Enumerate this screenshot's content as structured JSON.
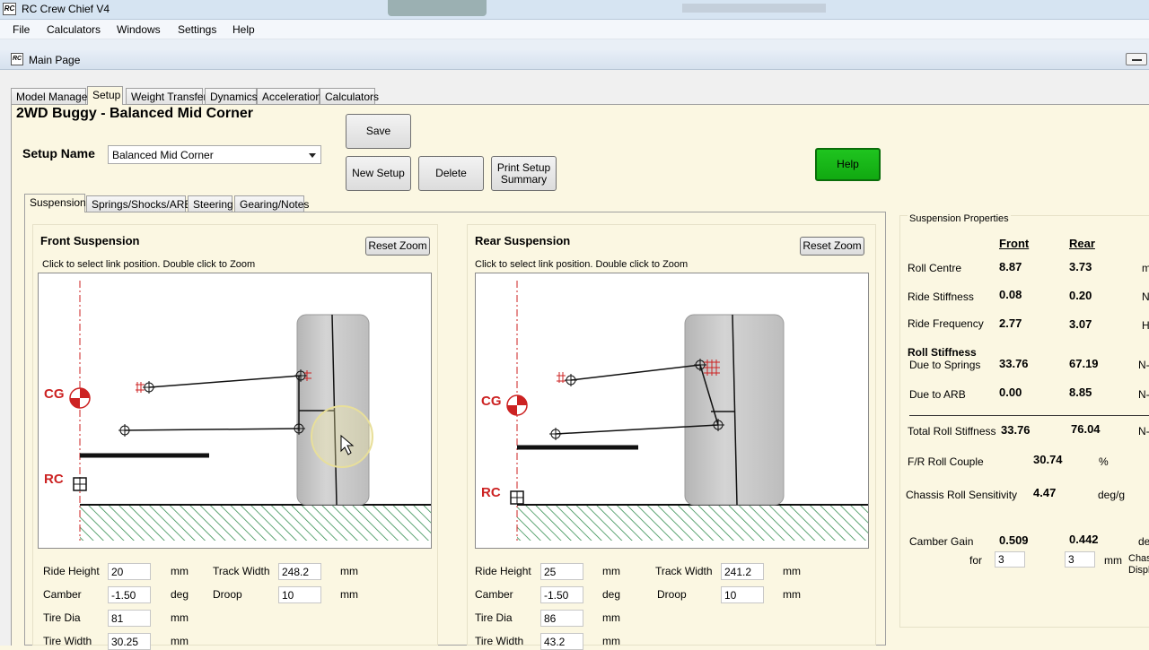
{
  "app": {
    "window_title": "RC Crew Chief V4",
    "menu": [
      "File",
      "Calculators",
      "Windows",
      "Settings",
      "Help"
    ]
  },
  "mdi": {
    "title": "Main Page"
  },
  "main_tabs": [
    "Model Manager",
    "Setup",
    "Weight Transfer",
    "Dynamics",
    "Acceleration",
    "Calculators"
  ],
  "model_title": "2WD Buggy - Balanced Mid Corner",
  "setup": {
    "name_label": "Setup Name",
    "selected": "Balanced Mid Corner"
  },
  "buttons": {
    "save": "Save",
    "new_setup": "New Setup",
    "delete": "Delete",
    "print_line1": "Print Setup",
    "print_line2": "Summary",
    "help": "Help"
  },
  "inner_tabs": [
    "Suspension",
    "Springs/Shocks/ARB",
    "Steering",
    "Gearing/Notes"
  ],
  "front": {
    "title": "Front Suspension",
    "reset_zoom": "Reset Zoom",
    "hint": "Click to select link position. Double click to Zoom",
    "cg": "CG",
    "rc": "RC",
    "ride_height_label": "Ride Height",
    "ride_height": "20",
    "ride_height_unit": "mm",
    "camber_label": "Camber",
    "camber": "-1.50",
    "camber_unit": "deg",
    "tire_dia_label": "Tire Dia",
    "tire_dia": "81",
    "tire_dia_unit": "mm",
    "tire_width_label": "Tire Width",
    "tire_width": "30.25",
    "tire_width_unit": "mm",
    "track_width_label": "Track Width",
    "track_width": "248.2",
    "track_width_unit": "mm",
    "droop_label": "Droop",
    "droop": "10",
    "droop_unit": "mm"
  },
  "rear": {
    "title": "Rear Suspension",
    "reset_zoom": "Reset Zoom",
    "hint": "Click to select link position. Double click to Zoom",
    "cg": "CG",
    "rc": "RC",
    "ride_height_label": "Ride Height",
    "ride_height": "25",
    "ride_height_unit": "mm",
    "camber_label": "Camber",
    "camber": "-1.50",
    "camber_unit": "deg",
    "tire_dia_label": "Tire Dia",
    "tire_dia": "86",
    "tire_dia_unit": "mm",
    "tire_width_label": "Tire Width",
    "tire_width": "43.2",
    "tire_width_unit": "mm",
    "track_width_label": "Track Width",
    "track_width": "241.2",
    "track_width_unit": "mm",
    "droop_label": "Droop",
    "droop": "10",
    "droop_unit": "mm"
  },
  "props": {
    "title": "Suspension Properties",
    "col_front": "Front",
    "col_rear": "Rear",
    "roll_centre_label": "Roll Centre",
    "roll_centre_front": "8.87",
    "roll_centre_rear": "3.73",
    "roll_centre_unit": "m",
    "ride_stiffness_label": "Ride Stiffness",
    "ride_stiffness_front": "0.08",
    "ride_stiffness_rear": "0.20",
    "ride_stiffness_unit": "N",
    "ride_frequency_label": "Ride Frequency",
    "ride_frequency_front": "2.77",
    "ride_frequency_rear": "3.07",
    "ride_frequency_unit": "H",
    "roll_stiffness_label": "Roll Stiffness",
    "due_springs_label": "Due to Springs",
    "due_springs_front": "33.76",
    "due_springs_rear": "67.19",
    "due_springs_unit": "N-",
    "due_arb_label": "Due to ARB",
    "due_arb_front": "0.00",
    "due_arb_rear": "8.85",
    "due_arb_unit": "N-",
    "total_roll_label": "Total Roll Stiffness",
    "total_roll_front": "33.76",
    "total_roll_rear": "76.04",
    "total_roll_unit": "N-",
    "fr_couple_label": "F/R Roll Couple",
    "fr_couple": "30.74",
    "fr_couple_unit": "%",
    "sensitivity_label": "Chassis Roll Sensitivity",
    "sensitivity": "4.47",
    "sensitivity_unit": "deg/g",
    "camber_gain_label": "Camber Gain",
    "camber_gain_front": "0.509",
    "camber_gain_rear": "0.442",
    "camber_gain_unit": "de",
    "for_label": "for",
    "for_front": "3",
    "for_rear": "3",
    "for_unit": "mm",
    "chassis_disp_line1": "Chas",
    "chassis_disp_line2": "Displ"
  },
  "colors": {
    "accent_red": "#cc2222",
    "help_green": "#17b817",
    "hatch_green": "#2c8a4a",
    "panel_bg": "#fbf7e2"
  }
}
